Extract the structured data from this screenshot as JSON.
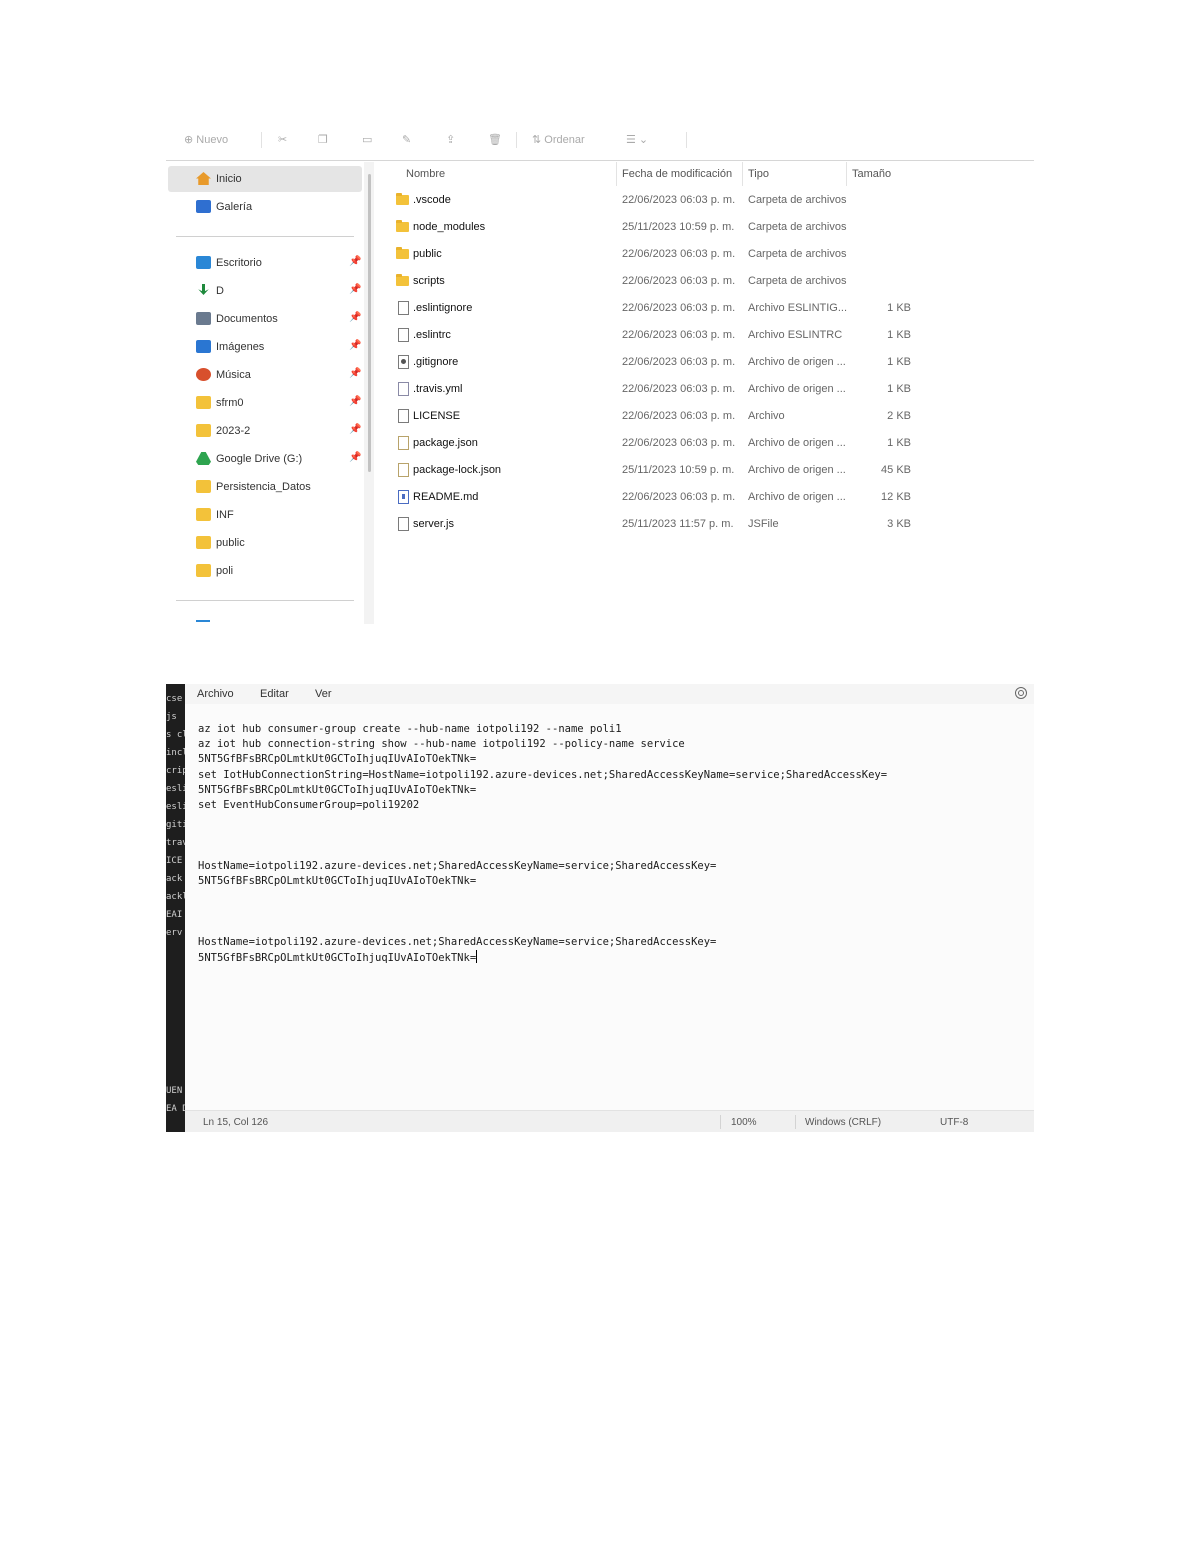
{
  "explorer": {
    "toolbar": {
      "new_label": "Nuevo",
      "view_label": "Ordenar"
    },
    "nav": [
      {
        "label": "Inicio",
        "icon": "home-icon",
        "color": "#e89a2b",
        "selected": true,
        "pinned": false
      },
      {
        "label": "Galería",
        "icon": "gallery-icon",
        "color": "#2f6fd0",
        "selected": false,
        "pinned": false
      },
      {
        "label": "Escritorio",
        "icon": "desktop-icon",
        "color": "#2a87d6",
        "selected": false,
        "pinned": true
      },
      {
        "label": "D",
        "icon": "download-icon",
        "color": "#1f8a3d",
        "selected": false,
        "pinned": true
      },
      {
        "label": "Documentos",
        "icon": "documents-icon",
        "color": "#6a7a8f",
        "selected": false,
        "pinned": true
      },
      {
        "label": "Imágenes",
        "icon": "pictures-icon",
        "color": "#2a76d2",
        "selected": false,
        "pinned": true
      },
      {
        "label": "Música",
        "icon": "music-icon",
        "color": "#d8502d",
        "selected": false,
        "pinned": true
      },
      {
        "label": "sfrm0",
        "icon": "folder-icon",
        "color": "#f3c23a",
        "selected": false,
        "pinned": true
      },
      {
        "label": "2023-2",
        "icon": "folder-icon",
        "color": "#f3c23a",
        "selected": false,
        "pinned": true
      },
      {
        "label": "Google Drive (G:)",
        "icon": "google-drive-icon",
        "color": "#2ea44f",
        "selected": false,
        "pinned": true
      },
      {
        "label": "Persistencia_Datos",
        "icon": "folder-icon",
        "color": "#f3c23a",
        "selected": false,
        "pinned": false
      },
      {
        "label": "INF",
        "icon": "folder-icon",
        "color": "#f3c23a",
        "selected": false,
        "pinned": false
      },
      {
        "label": "public",
        "icon": "folder-icon",
        "color": "#f3c23a",
        "selected": false,
        "pinned": false
      },
      {
        "label": "poli",
        "icon": "folder-icon",
        "color": "#f3c23a",
        "selected": false,
        "pinned": false
      }
    ],
    "columns": {
      "name": "Nombre",
      "date": "Fecha de modificación",
      "type": "Tipo",
      "size": "Tamaño"
    },
    "files": [
      {
        "name": ".vscode",
        "date": "22/06/2023 06:03 p. m.",
        "type": "Carpeta de archivos",
        "size": "",
        "kind": "folder"
      },
      {
        "name": "node_modules",
        "date": "25/11/2023 10:59 p. m.",
        "type": "Carpeta de archivos",
        "size": "",
        "kind": "folder"
      },
      {
        "name": "public",
        "date": "22/06/2023 06:03 p. m.",
        "type": "Carpeta de archivos",
        "size": "",
        "kind": "folder"
      },
      {
        "name": "scripts",
        "date": "22/06/2023 06:03 p. m.",
        "type": "Carpeta de archivos",
        "size": "",
        "kind": "folder"
      },
      {
        "name": ".eslintignore",
        "date": "22/06/2023 06:03 p. m.",
        "type": "Archivo ESLINTIG...",
        "size": "1 KB",
        "kind": "file"
      },
      {
        "name": ".eslintrc",
        "date": "22/06/2023 06:03 p. m.",
        "type": "Archivo ESLINTRC",
        "size": "1 KB",
        "kind": "file"
      },
      {
        "name": ".gitignore",
        "date": "22/06/2023 06:03 p. m.",
        "type": "Archivo de origen ...",
        "size": "1 KB",
        "kind": "git"
      },
      {
        "name": ".travis.yml",
        "date": "22/06/2023 06:03 p. m.",
        "type": "Archivo de origen ...",
        "size": "1 KB",
        "kind": "yml"
      },
      {
        "name": "LICENSE",
        "date": "22/06/2023 06:03 p. m.",
        "type": "Archivo",
        "size": "2 KB",
        "kind": "file"
      },
      {
        "name": "package.json",
        "date": "22/06/2023 06:03 p. m.",
        "type": "Archivo de origen ...",
        "size": "1 KB",
        "kind": "json"
      },
      {
        "name": "package-lock.json",
        "date": "25/11/2023 10:59 p. m.",
        "type": "Archivo de origen ...",
        "size": "45 KB",
        "kind": "json"
      },
      {
        "name": "README.md",
        "date": "22/06/2023 06:03 p. m.",
        "type": "Archivo de origen ...",
        "size": "12 KB",
        "kind": "md"
      },
      {
        "name": "server.js",
        "date": "25/11/2023 11:57 p. m.",
        "type": "JSFile",
        "size": "3 KB",
        "kind": "file"
      }
    ]
  },
  "notepad": {
    "menu": [
      "Archivo",
      "Editar",
      "Ver"
    ],
    "lines": [
      "az iot hub consumer-group create --hub-name iotpoli192 --name poli1",
      "az iot hub connection-string show --hub-name iotpoli192 --policy-name service",
      "5NT5GfBFsBRCpOLmtkUt0GCToIhjuqIUvAIoTOekTNk=",
      "set IotHubConnectionString=HostName=iotpoli192.azure-devices.net;SharedAccessKeyName=service;SharedAccessKey=",
      "5NT5GfBFsBRCpOLmtkUt0GCToIhjuqIUvAIoTOekTNk=",
      "set EventHubConsumerGroup=poli19202",
      "",
      "",
      "",
      "HostName=iotpoli192.azure-devices.net;SharedAccessKeyName=service;SharedAccessKey=",
      "5NT5GfBFsBRCpOLmtkUt0GCToIhjuqIUvAIoTOekTNk=",
      "",
      "",
      "",
      "HostName=iotpoli192.azure-devices.net;SharedAccessKeyName=service;SharedAccessKey=",
      "5NT5GfBFsBRCpOLmtkUt0GCToIhjuqIUvAIoTOekTNk="
    ],
    "strip": [
      "cse",
      "js",
      "s cl",
      "incl",
      "crip",
      "eslin",
      "eslin",
      "gitig",
      "travi",
      "ICE",
      "ack",
      "ackl",
      "EAI",
      "erv",
      "UEN",
      "EA D"
    ],
    "status": {
      "position": "Ln 15, Col 126",
      "zoom": "100%",
      "line_ending": "Windows (CRLF)",
      "encoding": "UTF-8"
    }
  }
}
